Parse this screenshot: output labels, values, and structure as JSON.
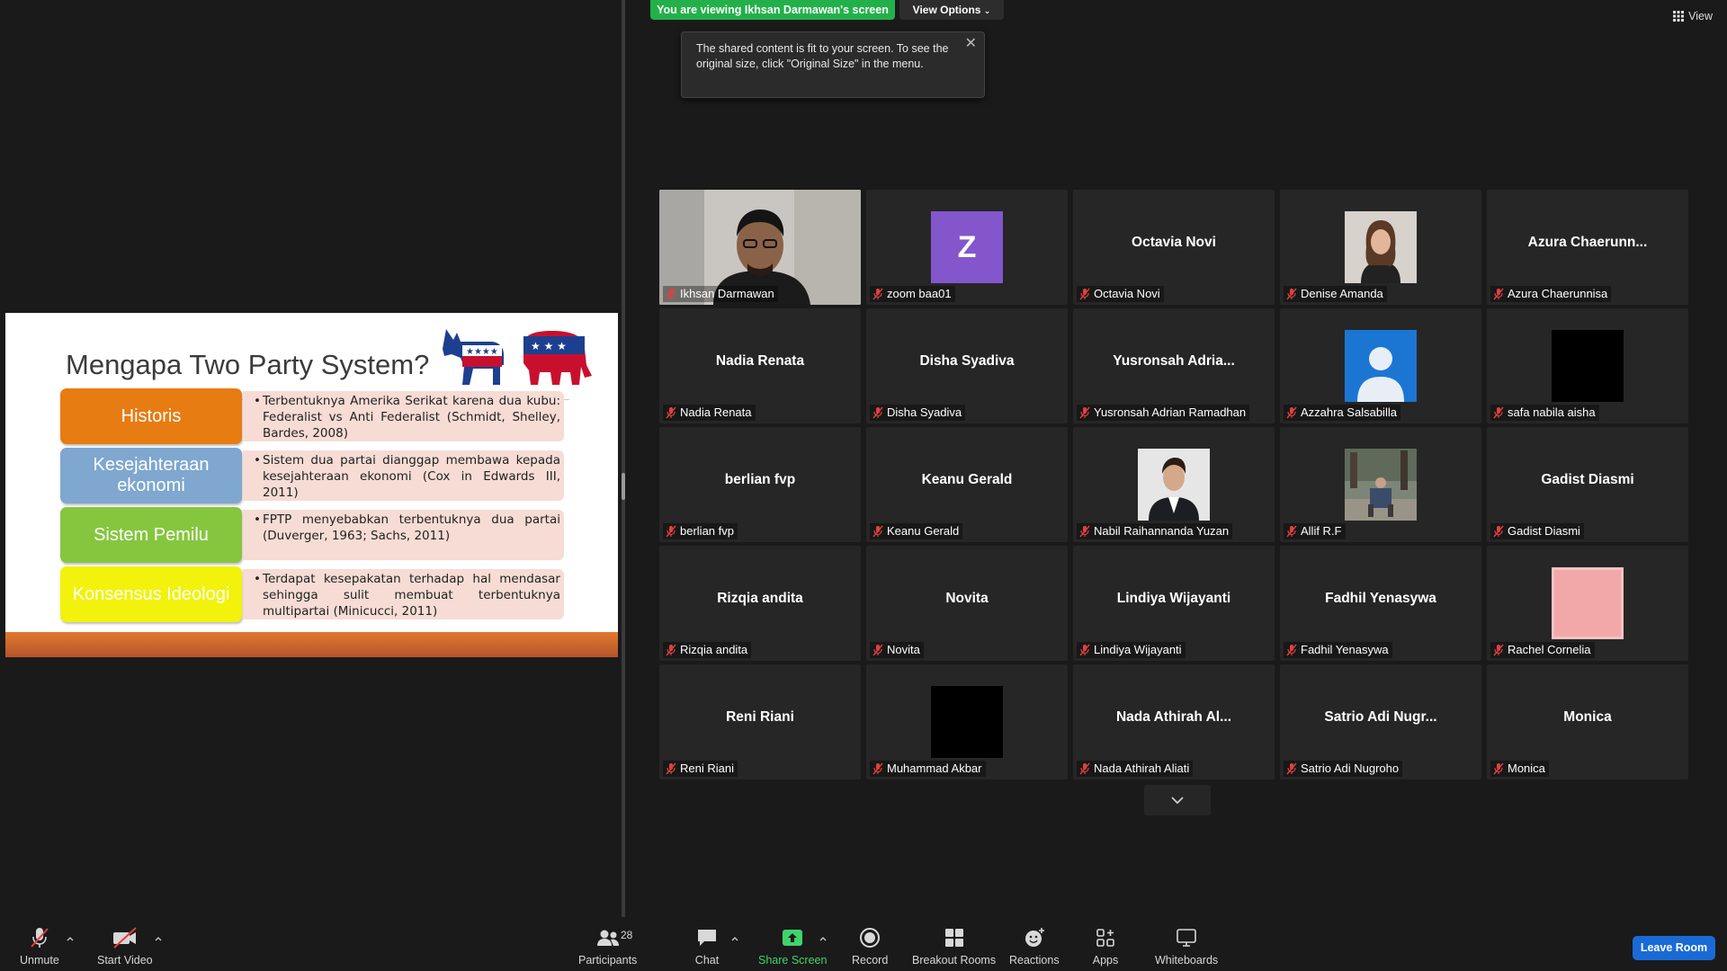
{
  "banner": {
    "viewing": "You are viewing Ikhsan Darmawan's screen",
    "view_options": "View Options"
  },
  "tooltip": {
    "text": "The shared content is fit to your screen. To see the original size, click \"Original Size\" in the menu."
  },
  "view_button": {
    "label": "View"
  },
  "slide": {
    "title": "Mengapa Two Party System?",
    "rows": [
      {
        "label": "Historis",
        "color": "#e77c12",
        "text": "Terbentuknya Amerika Serikat karena dua kubu: Federalist vs Anti Federalist (Schmidt, Shelley, Bardes, 2008)"
      },
      {
        "label": "Kesejahteraan ekonomi",
        "color": "#7fa7cf",
        "text": "Sistem dua partai dianggap membawa kepada kesejahteraan ekonomi (Cox in Edwards III, 2011)"
      },
      {
        "label": "Sistem Pemilu",
        "color": "#86c63f",
        "text": "FPTP menyebabkan terbentuknya dua partai (Duverger, 1963; Sachs, 2011)"
      },
      {
        "label": "Konsensus Ideologi",
        "color": "#f2f20c",
        "text": "Terdapat kesepakatan terhadap hal mendasar sehingga sulit membuat terbentuknya multipartai (Minicucci, 2011)"
      }
    ]
  },
  "participants": [
    {
      "tile": "",
      "label": "Ikhsan Darmawan",
      "type": "video"
    },
    {
      "tile": "Z",
      "label": "zoom baa01",
      "type": "letter"
    },
    {
      "tile": "Octavia Novi",
      "label": "Octavia Novi",
      "type": "name"
    },
    {
      "tile": "",
      "label": "Denise Amanda",
      "type": "photo-woman"
    },
    {
      "tile": "Azura  Chaerunn...",
      "label": "Azura Chaerunnisa",
      "type": "name"
    },
    {
      "tile": "Nadia Renata",
      "label": "Nadia Renata",
      "type": "name"
    },
    {
      "tile": "Disha Syadiva",
      "label": "Disha Syadiva",
      "type": "name"
    },
    {
      "tile": "Yusronsah  Adria...",
      "label": "Yusronsah Adrian Ramadhan",
      "type": "name"
    },
    {
      "tile": "",
      "label": "Azzahra Salsabilla",
      "type": "default-avatar"
    },
    {
      "tile": "",
      "label": "safa nabila aisha",
      "type": "black"
    },
    {
      "tile": "berlian fvp",
      "label": "berlian fvp",
      "type": "name"
    },
    {
      "tile": "Keanu Gerald",
      "label": "Keanu Gerald",
      "type": "name"
    },
    {
      "tile": "",
      "label": "Nabil Raihannanda Yuzan",
      "type": "photo-man"
    },
    {
      "tile": "",
      "label": "Allif R.F",
      "type": "photo-outdoor"
    },
    {
      "tile": "Gadist Diasmi",
      "label": "Gadist Diasmi",
      "type": "name"
    },
    {
      "tile": "Rizqia andita",
      "label": "Rizqia andita",
      "type": "name"
    },
    {
      "tile": "Novita",
      "label": "Novita",
      "type": "name"
    },
    {
      "tile": "Lindiya Wijayanti",
      "label": "Lindiya Wijayanti",
      "type": "name"
    },
    {
      "tile": "Fadhil Yenasywa",
      "label": "Fadhil Yenasywa",
      "type": "name"
    },
    {
      "tile": "",
      "label": "Rachel Cornelia",
      "type": "pink"
    },
    {
      "tile": "Reni Riani",
      "label": "Reni Riani",
      "type": "name"
    },
    {
      "tile": "",
      "label": "Muhammad Akbar",
      "type": "black"
    },
    {
      "tile": "Nada  Athirah  Al...",
      "label": "Nada Athirah Aliati",
      "type": "name"
    },
    {
      "tile": "Satrio  Adi  Nugr...",
      "label": "Satrio Adi Nugroho",
      "type": "name"
    },
    {
      "tile": "Monica",
      "label": "Monica",
      "type": "name"
    }
  ],
  "toolbar": {
    "unmute": "Unmute",
    "start_video": "Start Video",
    "participants": "Participants",
    "participants_count": "28",
    "chat": "Chat",
    "share_screen": "Share Screen",
    "record": "Record",
    "breakout_rooms": "Breakout Rooms",
    "reactions": "Reactions",
    "apps": "Apps",
    "whiteboards": "Whiteboards",
    "leave": "Leave Room"
  },
  "colors": {
    "accent_green": "#23b04a",
    "active_speaker": "#d6de42",
    "leave_blue": "#1a6ad6"
  }
}
